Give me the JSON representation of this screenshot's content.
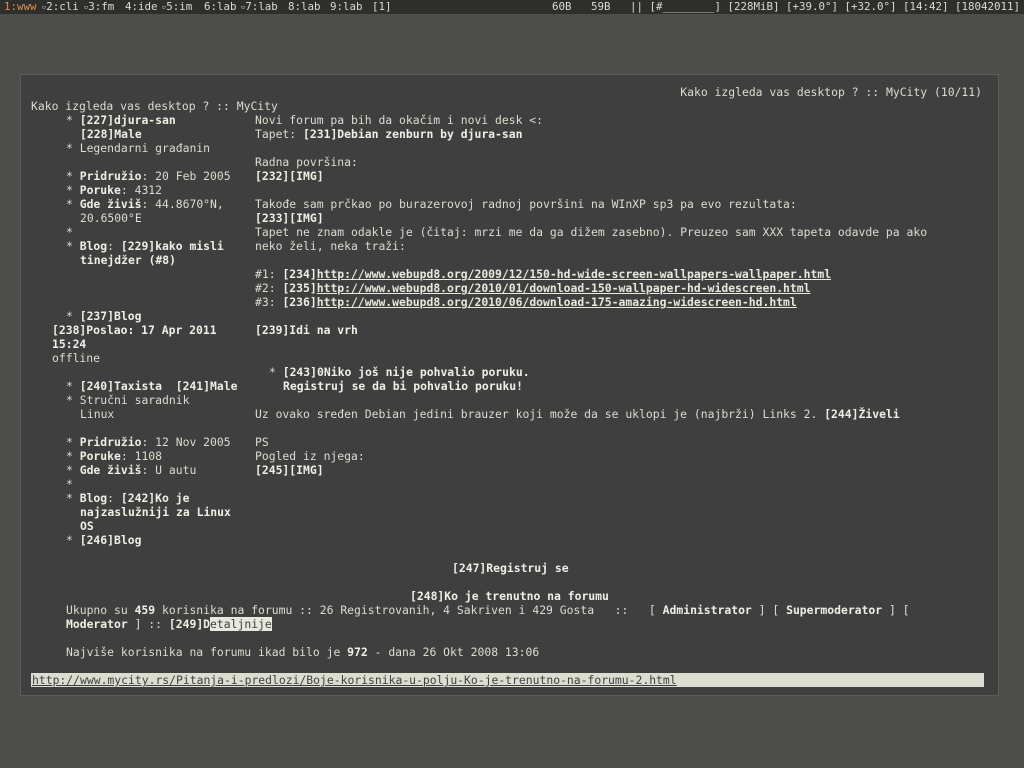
{
  "topbar": {
    "workspaces": [
      {
        "num": "1",
        "name": "www",
        "active": true
      },
      {
        "num": "2",
        "name": "cli",
        "active": false
      },
      {
        "num": "3",
        "name": "fm",
        "active": false
      },
      {
        "num": "4",
        "name": "ide",
        "active": false
      },
      {
        "num": "5",
        "name": "im",
        "active": false
      },
      {
        "num": "6",
        "name": "lab",
        "active": false
      },
      {
        "num": "7",
        "name": "lab",
        "active": false
      },
      {
        "num": "8",
        "name": "lab",
        "active": false
      },
      {
        "num": "9",
        "name": "lab",
        "active": false
      }
    ],
    "layout": "[1]",
    "status": "60B   59B   || [#________] [228MiB] [+39.0°] [+32.0°] [14:42] [18042011]"
  },
  "page": {
    "title_right": "Kako izgleda vas desktop ? :: MyCity (10/11)",
    "title_left": "Kako izgleda vas desktop ? :: MyCity",
    "post1": {
      "author": "[227]djura-san",
      "gender": "[228]Male",
      "rank": "Legendarni građanin",
      "joined_label": "Pridružio",
      "joined": ": 20 Feb 2005",
      "posts_label": "Poruke",
      "posts": ": 4312",
      "location_label": "Gde živiš",
      "location1": ": 44.8670°N,",
      "location2": "20.6500°E",
      "blog_label": "Blog",
      "blog_link1": "[229]kako misli",
      "blog_link2": "tinejdžer (#8)",
      "blog2": "[237]Blog",
      "sent_label": "[238]Poslao",
      "sent": ": 17 Apr 2011",
      "sent_time": "15:24",
      "status": "offline",
      "lines": {
        "l1": "Novi forum pa bih da okačim i novi desk <:",
        "l2_pre": "Tapet: ",
        "l2_link": "[231]Debian zenburn by djura-san",
        "l3": "Radna površina:",
        "l4": "[232][IMG]",
        "l5": "Takođe sam prčkao po burazerovoj radnoj površini na WInXP sp3 pa evo rezultata:",
        "l6": "[233][IMG]",
        "l7": "Tapet ne znam odakle je (čitaj: mrzi me da ga dižem zasebno). Preuzeo sam XXX tapeta odavde pa ako",
        "l8": "neko želi, neka traži:",
        "u1_pre": "#1: ",
        "u1_num": "[234]",
        "u1": "http://www.webupd8.org/2009/12/150-hd-wide-screen-wallpapers-wallpaper.html",
        "u2_pre": "#2: ",
        "u2_num": "[235]",
        "u2": "http://www.webupd8.org/2010/01/download-150-wallpaper-hd-widescreen.html",
        "u3_pre": "#3: ",
        "u3_num": "[236]",
        "u3": "http://www.webupd8.org/2010/06/download-175-amazing-widescreen-hd.html",
        "top": "[239]Idi na vrh",
        "nopraise1": "[243]0Niko još nije pohvalio poruku.",
        "nopraise2": "Registruj se da bi pohvalio poruku!"
      }
    },
    "post2": {
      "author": "[240]Taxista",
      "gender": "[241]Male",
      "rank1": "Stručni saradnik",
      "rank2": "Linux",
      "joined_label": "Pridružio",
      "joined": ": 12 Nov 2005",
      "posts_label": "Poruke",
      "posts": ": 1108",
      "location_label": "Gde živiš",
      "location": ": U autu",
      "blog_label": "Blog",
      "blog_link1": "[242]Ko je",
      "blog_link2": "najzaslužniji za Linux",
      "blog_link3": "OS",
      "blog2": "[246]Blog",
      "lines": {
        "l1_pre": "Uz ovako sređen Debian jedini brauzer koji može da se uklopi je (najbrži) Links 2. ",
        "l1_link": "[244]Živeli",
        "l2": "PS",
        "l3": "Pogled iz njega:",
        "l4": "[245][IMG]"
      }
    },
    "register": "[247]Registruj se",
    "who_online": "[248]Ko je trenutno na forumu",
    "online": {
      "pre": "Ukupno su ",
      "count": "459",
      "mid": " korisnika na forumu :: 26 Registrovanih, 4 Sakriven i 429 Gosta   ::   [ ",
      "admin": "Administrator",
      "sep1": " ] [ ",
      "supermod": "Supermoderator",
      "sep2": " ] [",
      "mod": "Moderator",
      "sep3": " ] :: ",
      "details_num": "[249]D",
      "details_rest": "etaljnije"
    },
    "record": {
      "pre": "Najviše korisnika na forumu ikad bilo je ",
      "count": "972",
      "post": " - dana 26 Okt 2008 13:06"
    },
    "status_url": "http://www.mycity.rs/Pitanja-i-predlozi/Boje-korisnika-u-polju-Ko-je-trenutno-na-forumu-2.html"
  }
}
